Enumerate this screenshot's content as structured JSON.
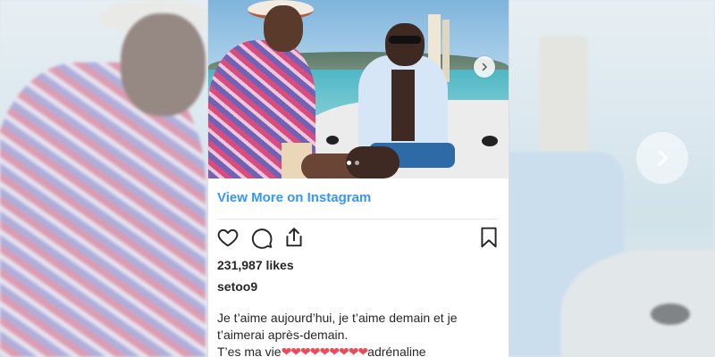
{
  "post": {
    "view_more_label": "View More on Instagram",
    "likes_text": "231,987 likes",
    "username": "setoo9",
    "caption_line1": "Je t’aime aujourd’hui, je t’aime demain et je",
    "caption_line2": "t’aimerai après-demain.",
    "caption_line3_prefix": "T’es ma vie",
    "caption_hearts": "❤❤❤❤❤❤❤❤❤",
    "caption_line3_suffix": "adrénaline"
  },
  "icons": {
    "like": "heart-icon",
    "comment": "comment-icon",
    "share": "share-icon",
    "save": "bookmark-icon",
    "next": "chevron-right-icon"
  },
  "colors": {
    "link": "#3897f0",
    "text": "#262626",
    "heart": "#ed4956"
  },
  "carousel": {
    "slide_count": 2,
    "active_index": 0
  }
}
